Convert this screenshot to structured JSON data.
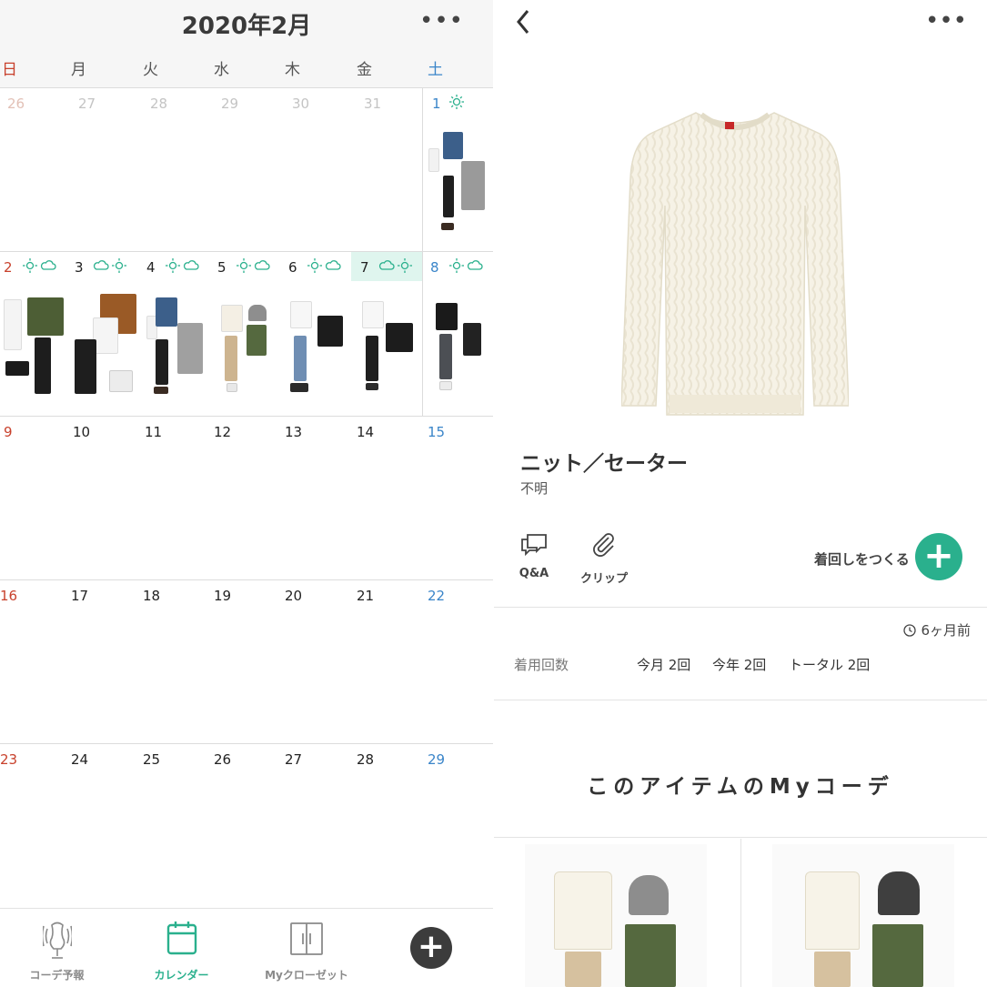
{
  "calendar": {
    "title": "2020年2月",
    "more": "•••",
    "weekdays": [
      "日",
      "月",
      "火",
      "水",
      "木",
      "金",
      "土"
    ],
    "weeks": [
      {
        "days": [
          "26",
          "27",
          "28",
          "29",
          "30",
          "31",
          "1"
        ]
      },
      {
        "days": [
          "2",
          "3",
          "4",
          "5",
          "6",
          "7",
          "8"
        ]
      },
      {
        "days": [
          "9",
          "10",
          "11",
          "12",
          "13",
          "14",
          "15"
        ]
      },
      {
        "days": [
          "16",
          "17",
          "18",
          "19",
          "20",
          "21",
          "22"
        ]
      },
      {
        "days": [
          "23",
          "24",
          "25",
          "26",
          "27",
          "28",
          "29"
        ]
      }
    ],
    "today": "7",
    "weather_icons": [
      "sun-icon",
      "cloud-icon"
    ]
  },
  "bottom_nav": {
    "items": [
      {
        "label": "コーデ予報",
        "icon": "mannequin-icon"
      },
      {
        "label": "カレンダー",
        "icon": "calendar-icon",
        "active": true
      },
      {
        "label": "Myクローゼット",
        "icon": "closet-icon"
      }
    ],
    "plus": "+"
  },
  "item": {
    "back": "‹",
    "more": "•••",
    "name": "ニット／セーター",
    "brand": "不明",
    "actions": [
      {
        "label": "Q&A",
        "icon": "speech-bubbles-icon"
      },
      {
        "label": "クリップ",
        "icon": "paperclip-icon"
      }
    ],
    "wear_again": "着回しをつくる",
    "time_ago": "6ヶ月前",
    "wear_count_label": "着用回数",
    "wear_counts": [
      "今月 2回",
      "今年 2回",
      "トータル 2回"
    ],
    "my_coords_title": "このアイテムのMyコーデ"
  },
  "colors": {
    "accent": "#2ab08d",
    "sunday": "#c8412c",
    "saturday": "#3a85c9",
    "today_bg": "#dff5ee"
  }
}
